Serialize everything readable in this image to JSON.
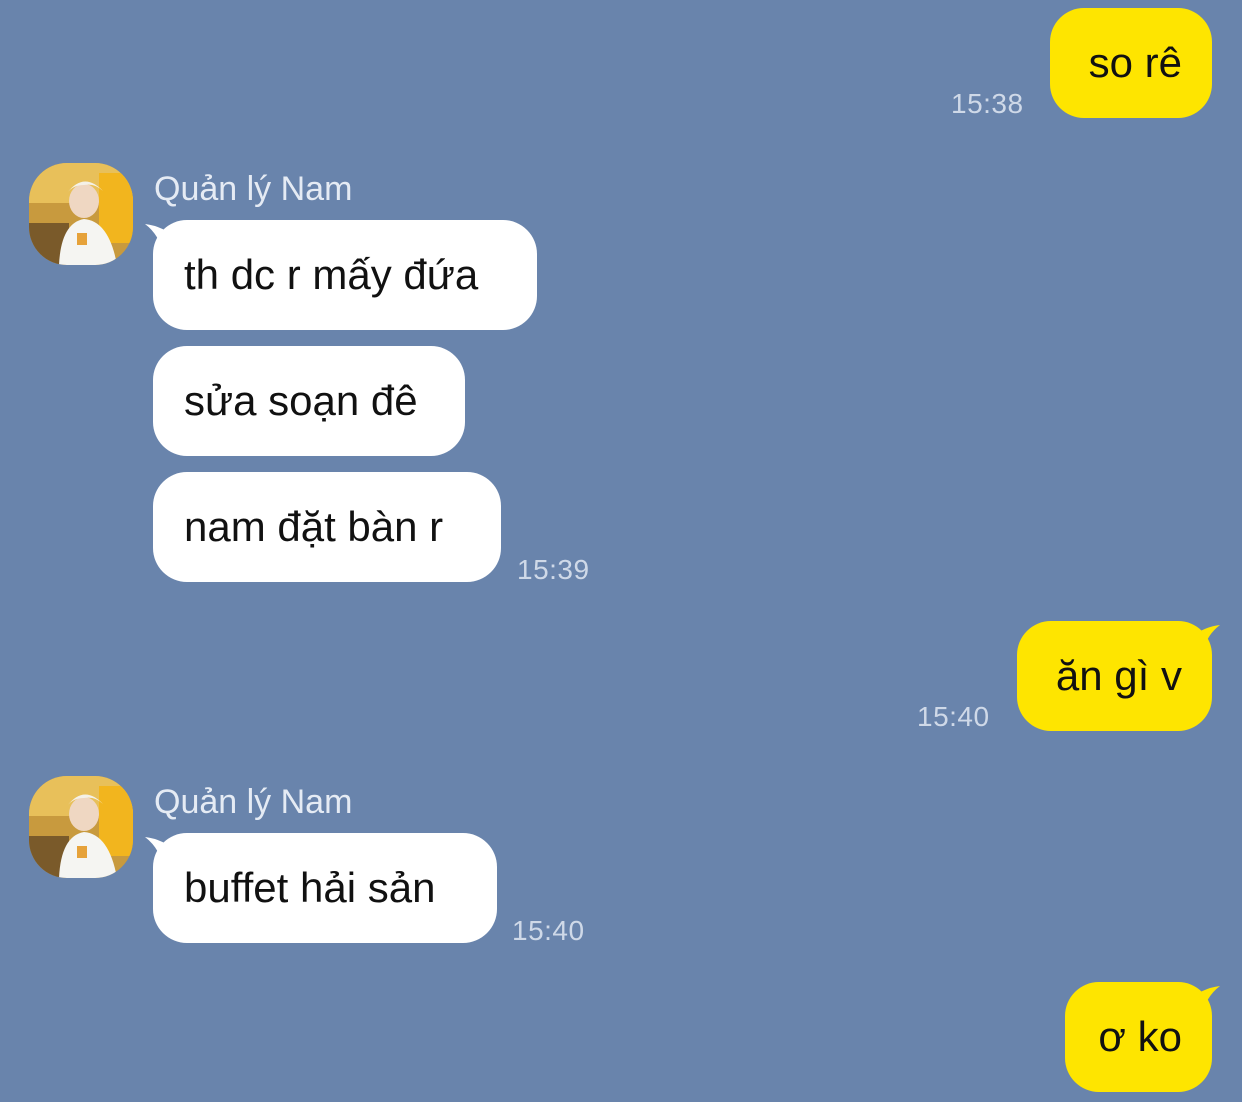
{
  "conversation": {
    "sender_name": "Quản lý Nam",
    "messages": [
      {
        "direction": "outgoing",
        "text": "so rê",
        "time": "15:38"
      },
      {
        "direction": "incoming",
        "text": "th dc r mấy đứa"
      },
      {
        "direction": "incoming",
        "text": "sửa soạn đê"
      },
      {
        "direction": "incoming",
        "text": "nam đặt bàn r",
        "time": "15:39"
      },
      {
        "direction": "outgoing",
        "text": "ăn gì v",
        "time": "15:40"
      },
      {
        "direction": "incoming",
        "text": "buffet hải sản",
        "time": "15:40"
      },
      {
        "direction": "outgoing",
        "text": "ơ ko"
      }
    ]
  },
  "theme": {
    "background": "#6984ac",
    "outgoing_bubble": "#fee500",
    "incoming_bubble": "#ffffff",
    "timestamp_color": "#cfd9e8"
  }
}
